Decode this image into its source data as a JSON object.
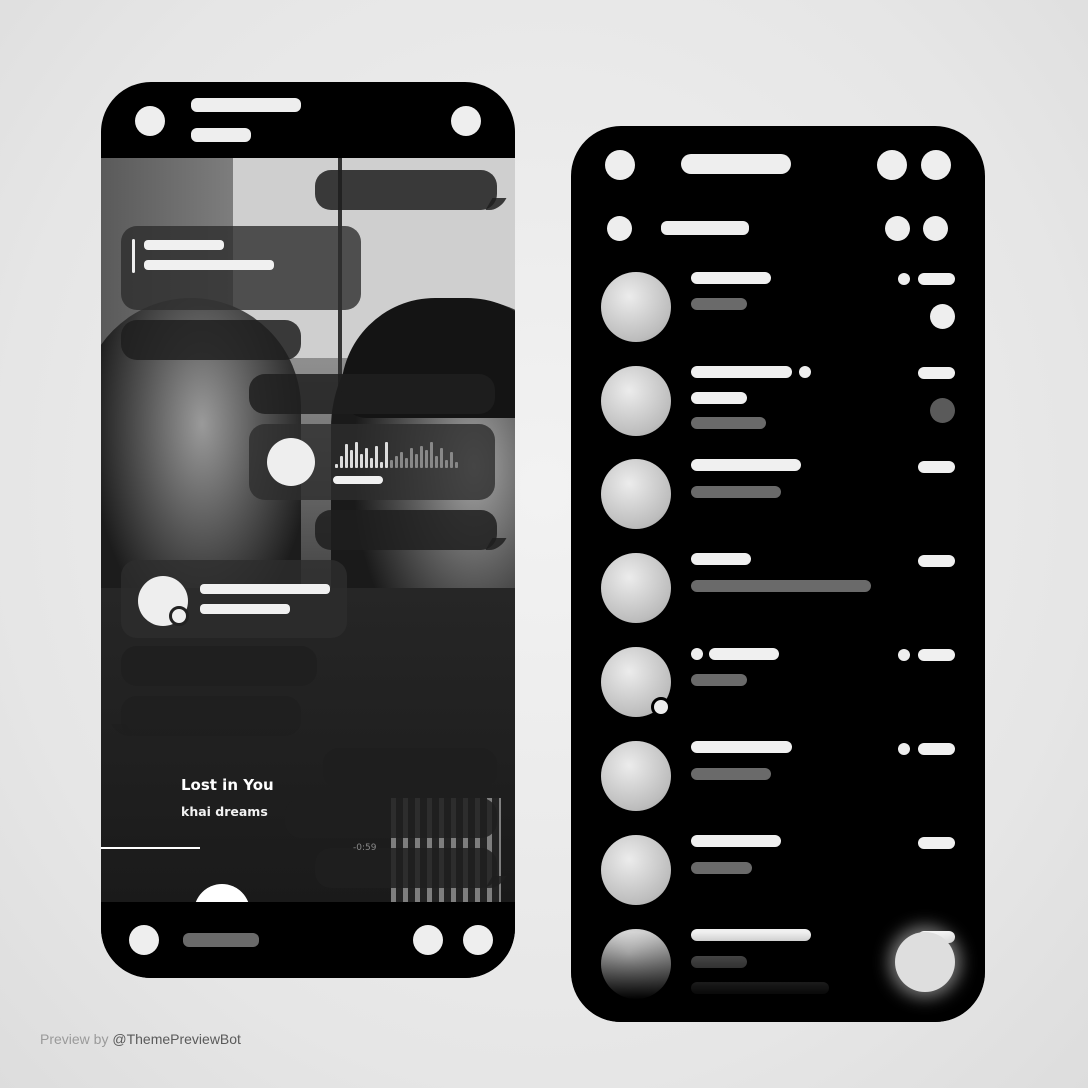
{
  "now_playing": {
    "title": "Lost in You",
    "artist": "khai dreams",
    "time": "-0:59",
    "progress": 0.24
  },
  "footer": {
    "prefix": "Preview by",
    "handle": "@ThemePreviewBot"
  },
  "colors": {
    "background": "#e6e6e6",
    "phone": "#000000",
    "accent_light": "#f0f0f0",
    "muted": "#6a6a6a"
  },
  "icons": {
    "left_top": [
      "back-icon",
      "avatar-icon"
    ],
    "left_bottom": [
      "attach-icon",
      "emoji-icon",
      "mic-icon"
    ],
    "right_top": [
      "menu-icon",
      "search-icon",
      "settings-icon"
    ],
    "right_tabs": [
      "tab-icon",
      "tab-icon",
      "tab-icon"
    ]
  }
}
